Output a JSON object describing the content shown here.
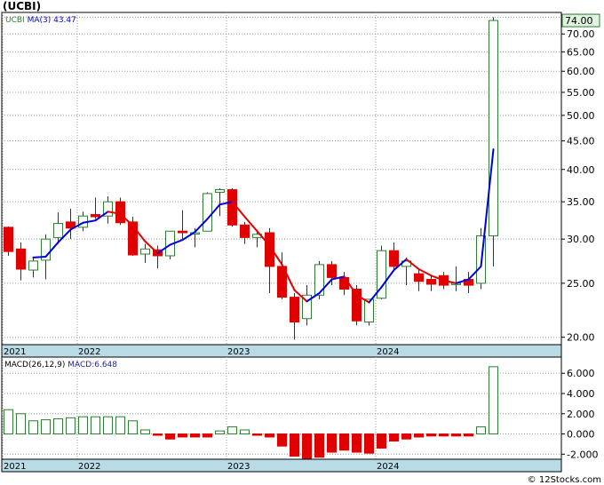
{
  "title": "(UCBI)",
  "credit": "© 12Stocks.com",
  "colors": {
    "up": "#2e7d32",
    "down": "#e00000",
    "ma_up": "#0000dd",
    "ma_down": "#e00000",
    "band": "#b8dbe6",
    "macd_label": "#2222aa"
  },
  "chart_data": [
    {
      "type": "candlestick",
      "legend": {
        "ticker": "UCBI",
        "ma_label": "MA(3)",
        "ma_value": "43.47"
      },
      "last_price_label": "74.00",
      "scale": "log",
      "ylim": [
        19.4,
        76.5
      ],
      "y_ticks": [
        "75.00",
        "70.00",
        "65.00",
        "60.00",
        "55.00",
        "50.00",
        "45.00",
        "40.00",
        "35.00",
        "30.00",
        "25.00",
        "20.00"
      ],
      "x_ticks": [
        {
          "label": "2021",
          "index": 0
        },
        {
          "label": "2022",
          "index": 6
        },
        {
          "label": "2023",
          "index": 18
        },
        {
          "label": "2024",
          "index": 30
        }
      ],
      "candles": [
        {
          "o": 31.5,
          "h": 31.6,
          "l": 28.0,
          "c": 28.5
        },
        {
          "o": 28.8,
          "h": 29.6,
          "l": 25.3,
          "c": 26.5
        },
        {
          "o": 26.4,
          "h": 27.8,
          "l": 25.6,
          "c": 27.4
        },
        {
          "o": 27.5,
          "h": 30.6,
          "l": 25.4,
          "c": 30.0
        },
        {
          "o": 30.2,
          "h": 33.5,
          "l": 29.4,
          "c": 32.0
        },
        {
          "o": 32.2,
          "h": 34.0,
          "l": 30.0,
          "c": 31.4
        },
        {
          "o": 31.5,
          "h": 33.6,
          "l": 31.0,
          "c": 33.0
        },
        {
          "o": 33.2,
          "h": 35.6,
          "l": 32.6,
          "c": 32.9
        },
        {
          "o": 33.0,
          "h": 35.8,
          "l": 32.0,
          "c": 35.0
        },
        {
          "o": 35.0,
          "h": 35.6,
          "l": 31.8,
          "c": 32.1
        },
        {
          "o": 32.2,
          "h": 32.9,
          "l": 28.0,
          "c": 28.1
        },
        {
          "o": 28.2,
          "h": 29.4,
          "l": 27.2,
          "c": 28.8
        },
        {
          "o": 28.7,
          "h": 29.2,
          "l": 26.6,
          "c": 28.0
        },
        {
          "o": 28.0,
          "h": 31.0,
          "l": 27.6,
          "c": 31.0
        },
        {
          "o": 31.0,
          "h": 33.8,
          "l": 30.0,
          "c": 30.8
        },
        {
          "o": 30.8,
          "h": 31.4,
          "l": 29.0,
          "c": 30.8
        },
        {
          "o": 31.0,
          "h": 36.4,
          "l": 31.0,
          "c": 36.2
        },
        {
          "o": 36.4,
          "h": 37.0,
          "l": 33.0,
          "c": 36.8
        },
        {
          "o": 36.8,
          "h": 37.0,
          "l": 31.6,
          "c": 31.8
        },
        {
          "o": 31.8,
          "h": 32.2,
          "l": 29.4,
          "c": 30.2
        },
        {
          "o": 30.2,
          "h": 31.2,
          "l": 29.0,
          "c": 30.6
        },
        {
          "o": 30.8,
          "h": 31.4,
          "l": 24.0,
          "c": 26.8
        },
        {
          "o": 26.8,
          "h": 28.4,
          "l": 23.4,
          "c": 23.6
        },
        {
          "o": 23.6,
          "h": 24.0,
          "l": 19.8,
          "c": 21.3
        },
        {
          "o": 21.6,
          "h": 24.8,
          "l": 21.0,
          "c": 23.8
        },
        {
          "o": 23.8,
          "h": 27.4,
          "l": 23.4,
          "c": 27.0
        },
        {
          "o": 27.0,
          "h": 27.4,
          "l": 24.8,
          "c": 25.6
        },
        {
          "o": 25.6,
          "h": 26.2,
          "l": 23.8,
          "c": 24.4
        },
        {
          "o": 24.4,
          "h": 24.8,
          "l": 21.0,
          "c": 21.4
        },
        {
          "o": 21.3,
          "h": 23.4,
          "l": 21.0,
          "c": 23.4
        },
        {
          "o": 23.5,
          "h": 29.2,
          "l": 23.4,
          "c": 28.6
        },
        {
          "o": 28.6,
          "h": 29.6,
          "l": 26.4,
          "c": 26.8
        },
        {
          "o": 26.8,
          "h": 27.8,
          "l": 24.8,
          "c": 27.4
        },
        {
          "o": 26.0,
          "h": 26.4,
          "l": 24.2,
          "c": 25.2
        },
        {
          "o": 25.4,
          "h": 25.8,
          "l": 24.2,
          "c": 24.9
        },
        {
          "o": 25.8,
          "h": 26.2,
          "l": 24.4,
          "c": 24.8
        },
        {
          "o": 25.0,
          "h": 26.8,
          "l": 24.2,
          "c": 25.0
        },
        {
          "o": 25.4,
          "h": 26.2,
          "l": 24.0,
          "c": 24.8
        },
        {
          "o": 25.0,
          "h": 31.4,
          "l": 24.4,
          "c": 30.4
        },
        {
          "o": 30.4,
          "h": 75.0,
          "l": 26.8,
          "c": 74.0
        }
      ],
      "ma": [
        null,
        null,
        27.8,
        27.9,
        29.6,
        31.2,
        32.1,
        32.4,
        33.6,
        33.3,
        31.7,
        29.7,
        28.3,
        29.3,
        29.9,
        30.9,
        32.6,
        34.6,
        35.0,
        32.9,
        31.0,
        29.2,
        27.0,
        24.3,
        23.2,
        24.0,
        25.4,
        25.7,
        23.8,
        23.1,
        24.6,
        26.4,
        27.6,
        26.5,
        25.8,
        25.3,
        25.0,
        25.4,
        26.8,
        43.47
      ]
    },
    {
      "type": "bar",
      "legend": {
        "label": "MACD(26,12,9)",
        "value_label": "MACD:6.648"
      },
      "ylim": [
        -2.5,
        7.6
      ],
      "y_ticks": [
        "6.000",
        "4.000",
        "2.000",
        "0.000",
        "-2.000"
      ],
      "y_tick_values": [
        6,
        4,
        2,
        0,
        -2
      ],
      "values": [
        2.4,
        2.0,
        1.3,
        1.4,
        1.5,
        1.6,
        1.7,
        1.7,
        1.7,
        1.7,
        1.3,
        0.4,
        -0.05,
        -0.5,
        -0.3,
        -0.3,
        -0.3,
        0.3,
        0.7,
        0.4,
        -0.05,
        -0.3,
        -1.2,
        -2.2,
        -2.6,
        -2.3,
        -1.8,
        -1.6,
        -1.8,
        -1.9,
        -1.4,
        -0.7,
        -0.5,
        -0.3,
        -0.2,
        -0.2,
        -0.2,
        -0.2,
        0.7,
        6.648
      ]
    }
  ]
}
